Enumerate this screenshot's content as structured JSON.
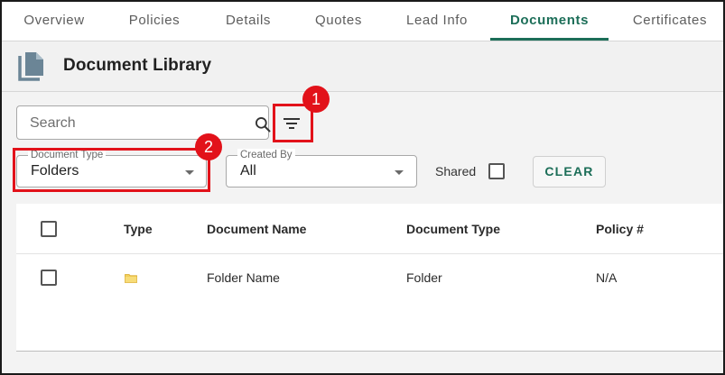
{
  "tabs": [
    {
      "label": "Overview"
    },
    {
      "label": "Policies"
    },
    {
      "label": "Details"
    },
    {
      "label": "Quotes"
    },
    {
      "label": "Lead Info"
    },
    {
      "label": "Documents"
    },
    {
      "label": "Certificates"
    }
  ],
  "active_tab": "Documents",
  "header": {
    "title": "Document Library",
    "icon": "document-icon"
  },
  "search": {
    "placeholder": "Search",
    "value": "",
    "icon": "search-icon"
  },
  "filter_button": {
    "icon": "filter-list-icon"
  },
  "annotations": {
    "first": "1",
    "second": "2",
    "color": "#e2121a"
  },
  "filters": {
    "document_type": {
      "label": "Document Type",
      "value": "Folders"
    },
    "created_by": {
      "label": "Created By",
      "value": "All"
    },
    "shared_label": "Shared",
    "shared_checked": false,
    "clear_label": "CLEAR"
  },
  "table": {
    "columns": {
      "type": "Type",
      "document_name": "Document Name",
      "document_type": "Document Type",
      "policy": "Policy #"
    },
    "rows": [
      {
        "type_icon": "folder-icon",
        "document_name": "Folder Name",
        "document_type": "Folder",
        "policy": "N/A"
      }
    ]
  },
  "colors": {
    "accent": "#1c6e58",
    "annotation": "#e2121a",
    "folder": "#f2cf5b"
  }
}
